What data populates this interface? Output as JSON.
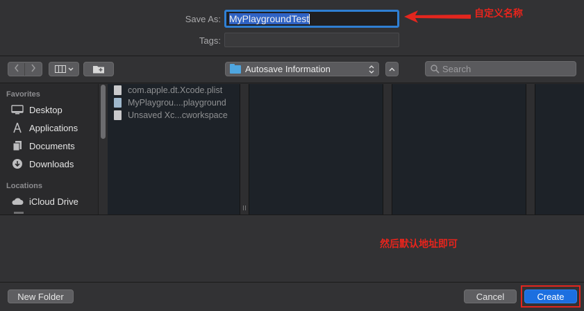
{
  "save": {
    "save_as_label": "Save As:",
    "save_as_value": "MyPlaygroundTest",
    "tags_label": "Tags:",
    "tags_value": ""
  },
  "annotations": {
    "name_note": "自定义名称",
    "location_note": "然后默认地址即可"
  },
  "toolbar": {
    "location": "Autosave Information",
    "search_placeholder": "Search"
  },
  "sidebar": {
    "favorites_title": "Favorites",
    "favorites": [
      {
        "label": "Desktop",
        "icon": "desktop-icon"
      },
      {
        "label": "Applications",
        "icon": "applications-icon"
      },
      {
        "label": "Documents",
        "icon": "documents-icon"
      },
      {
        "label": "Downloads",
        "icon": "downloads-icon"
      }
    ],
    "locations_title": "Locations",
    "locations": [
      {
        "label": "iCloud Drive",
        "icon": "cloud-icon"
      }
    ]
  },
  "files": [
    {
      "name": "com.apple.dt.Xcode.plist",
      "icon": "document-icon"
    },
    {
      "name": "MyPlaygrou....playground",
      "icon": "playground-icon"
    },
    {
      "name": "Unsaved Xc...cworkspace",
      "icon": "document-icon"
    }
  ],
  "footer": {
    "new_folder": "New Folder",
    "cancel": "Cancel",
    "create": "Create"
  },
  "colors": {
    "accent": "#1c6fe0",
    "annotation": "#e3261e",
    "focus_ring": "#2f7fd3"
  }
}
